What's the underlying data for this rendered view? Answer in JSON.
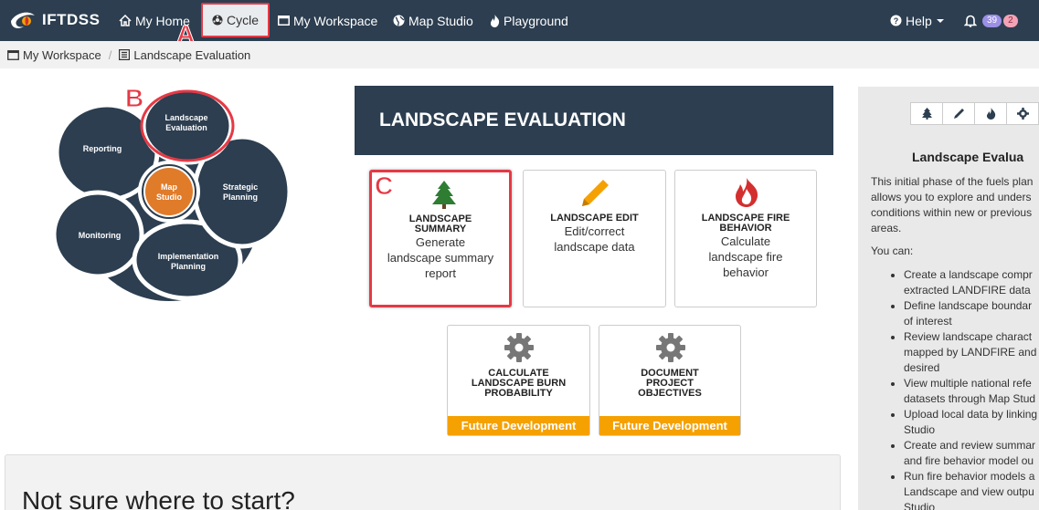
{
  "brand": {
    "name": "IFTDSS"
  },
  "nav": {
    "my_home": "My Home",
    "cycle": "Cycle",
    "my_workspace": "My Workspace",
    "map_studio": "Map Studio",
    "playground": "Playground",
    "help": "Help",
    "notifications_count": "39",
    "alerts_count": "2"
  },
  "breadcrumb": {
    "items": [
      "My Workspace",
      "Landscape Evaluation"
    ]
  },
  "annotations": {
    "a": "A",
    "b": "B",
    "c": "C"
  },
  "cycle": {
    "landscape_evaluation": [
      "Landscape",
      "Evaluation"
    ],
    "strategic_planning": [
      "Strategic",
      "Planning"
    ],
    "implementation_planning": [
      "Implementation",
      "Planning"
    ],
    "monitoring": "Monitoring",
    "reporting": "Reporting",
    "map_studio": [
      "Map",
      "Studio"
    ],
    "colors": {
      "petal": "#2c3e50",
      "center": "#e07b2a",
      "highlight": "#e53945"
    }
  },
  "header": {
    "title": "LANDSCAPE EVALUATION"
  },
  "tools": [
    {
      "title": [
        "LANDSCAPE",
        "SUMMARY"
      ],
      "desc": [
        "Generate",
        "landscape summary",
        "report"
      ],
      "icon": "tree-icon",
      "color": "#2e7d32"
    },
    {
      "title": [
        "LANDSCAPE EDIT"
      ],
      "desc": [
        "Edit/correct",
        "landscape data"
      ],
      "icon": "pencil-icon",
      "color": "#f5a102"
    },
    {
      "title": [
        "LANDSCAPE FIRE",
        "BEHAVIOR"
      ],
      "desc": [
        "Calculate",
        "landscape fire",
        "behavior"
      ],
      "icon": "fire-icon",
      "color": "#d32f2f"
    },
    {
      "title": [
        "CALCULATE",
        "LANDSCAPE BURN",
        "PROBABILITY"
      ],
      "future": "Future Development",
      "icon": "gear-icon",
      "color": "#777777"
    },
    {
      "title": [
        "DOCUMENT",
        "PROJECT",
        "OBJECTIVES"
      ],
      "future": "Future Development",
      "icon": "gear-icon",
      "color": "#777777"
    }
  ],
  "side": {
    "title": "Landscape Evalua",
    "intro": [
      "This initial phase of the fuels plan",
      "allows you to explore and unders",
      "conditions within new or previous",
      "areas."
    ],
    "you_can": "You can:",
    "bullets": [
      [
        "Create a landscape compr",
        "extracted LANDFIRE data"
      ],
      [
        "Define landscape boundar",
        "of interest"
      ],
      [
        "Review landscape charact",
        "mapped by LANDFIRE and",
        "desired"
      ],
      [
        "View multiple national refe",
        "datasets through Map Stud"
      ],
      [
        "Upload local data by linking",
        "Studio"
      ],
      [
        "Create and review summar",
        "and fire behavior model ou"
      ],
      [
        "Run fire behavior models a",
        "Landscape and view outpu",
        "Studio"
      ]
    ]
  },
  "prompt": {
    "title": "Not sure where to start?"
  }
}
